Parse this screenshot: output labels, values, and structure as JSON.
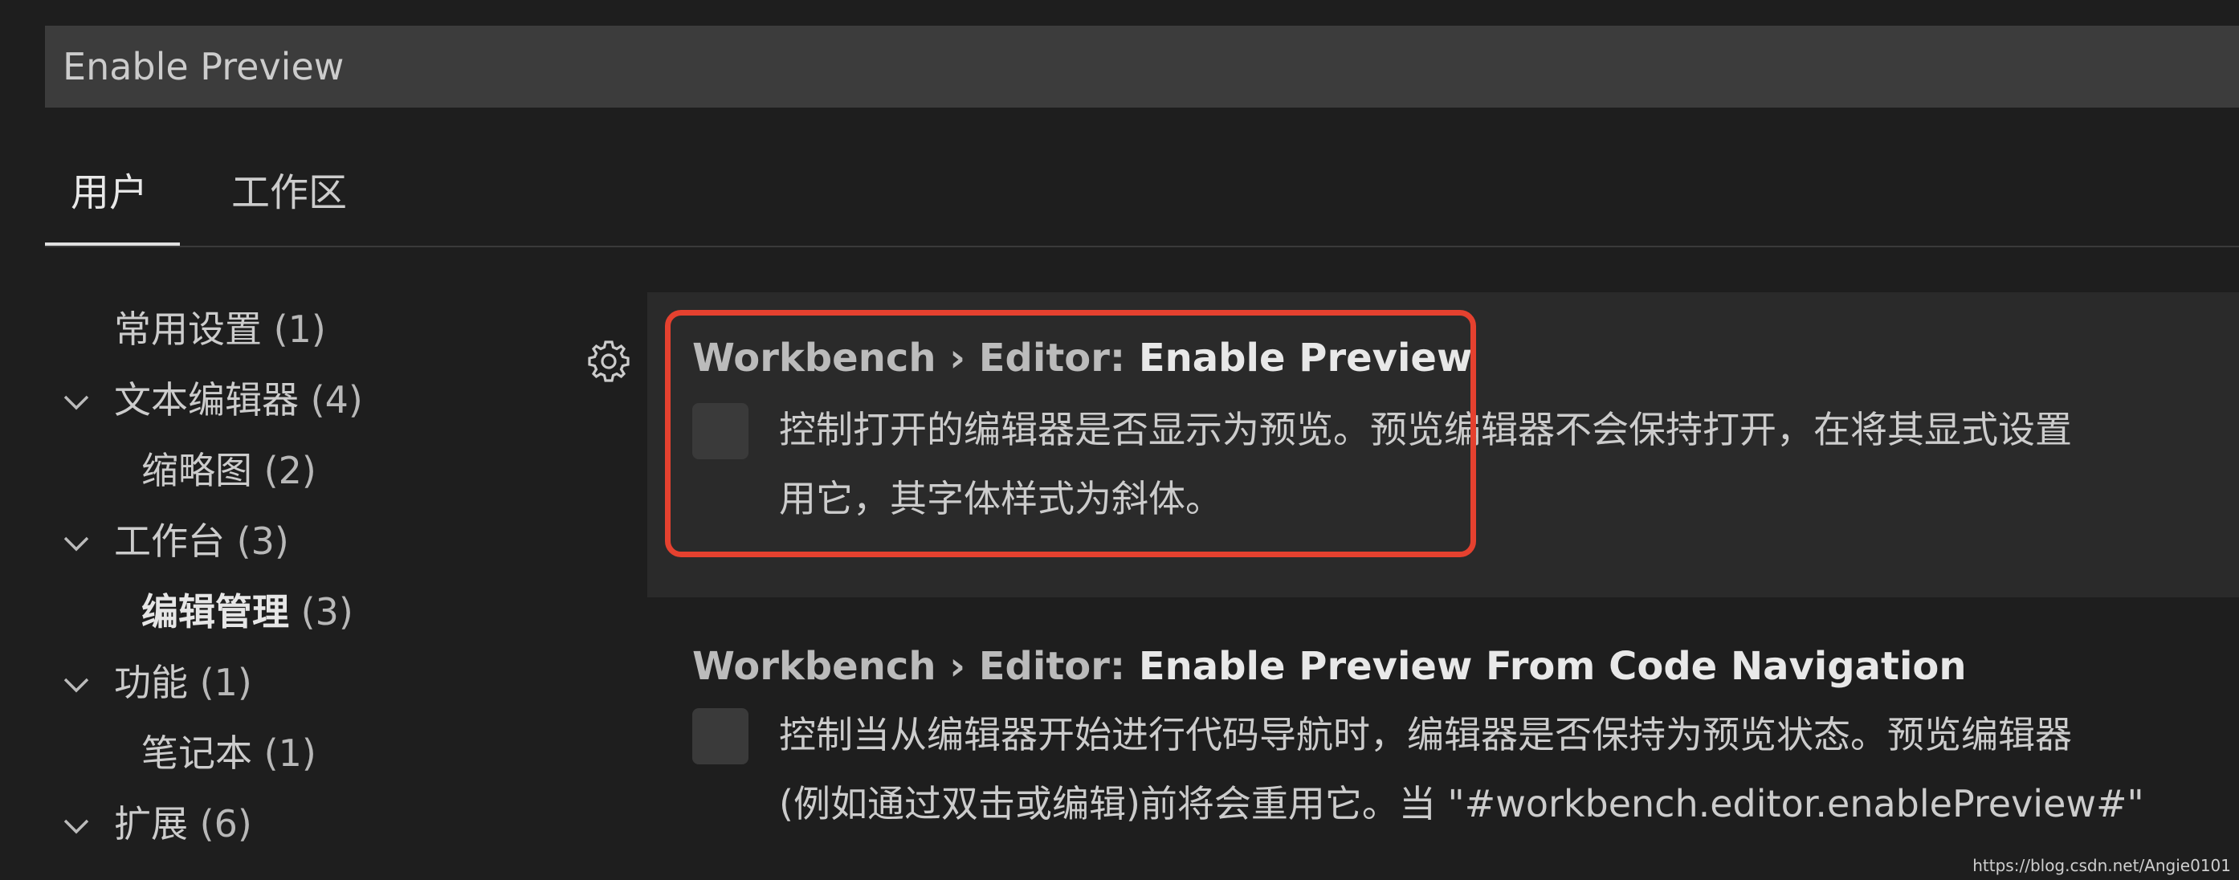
{
  "search": {
    "value": "Enable Preview"
  },
  "tabs": [
    {
      "label": "用户"
    },
    {
      "label": "工作区"
    }
  ],
  "toc": [
    {
      "label": "常用设置",
      "count": "(1)"
    },
    {
      "label": "文本编辑器",
      "count": "(4)"
    },
    {
      "label": "缩略图",
      "count": "(2)"
    },
    {
      "label": "工作台",
      "count": "(3)"
    },
    {
      "label": "编辑管理",
      "count": "(3)"
    },
    {
      "label": "功能",
      "count": "(1)"
    },
    {
      "label": "笔记本",
      "count": "(1)"
    },
    {
      "label": "扩展",
      "count": "(6)"
    }
  ],
  "settings": [
    {
      "category": "Workbench › Editor: ",
      "name": "Enable Preview",
      "desc_line1": "控制打开的编辑器是否显示为预览。预览编辑器不会保持打开，在将其显式设置",
      "desc_line2": "用它，其字体样式为斜体。"
    },
    {
      "category": "Workbench › Editor: ",
      "name": "Enable Preview From Code Navigation",
      "desc_line1": "控制当从编辑器开始进行代码导航时，编辑器是否保持为预览状态。预览编辑器",
      "desc_line2": "(例如通过双击或编辑)前将会重用它。当 \"#workbench.editor.enablePreview#\""
    }
  ],
  "watermark": "https://blog.csdn.net/Angie0101",
  "colors": {
    "background": "#1e1e1e",
    "highlight": "#e5412f",
    "focused_row": "#2a2a2a"
  }
}
